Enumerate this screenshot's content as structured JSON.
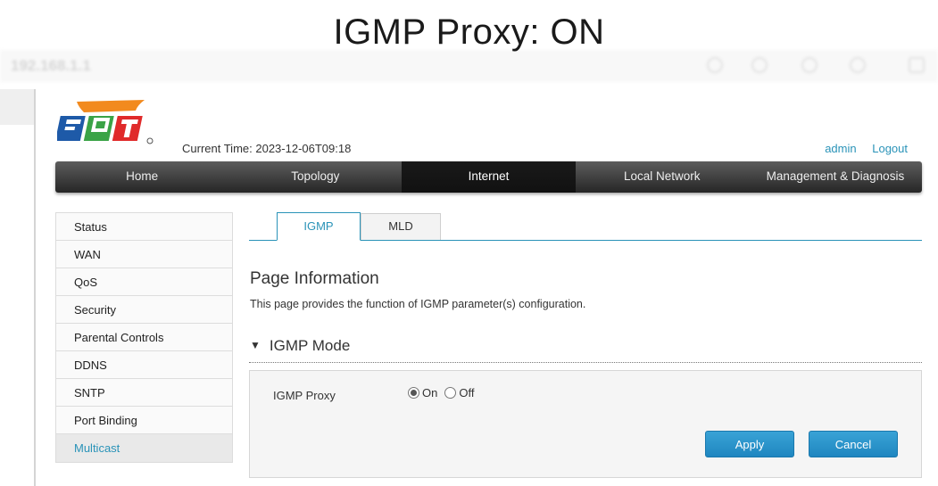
{
  "caption": "IGMP Proxy: ON",
  "browser": {
    "url": "192.168.1.1"
  },
  "header": {
    "current_time": "Current Time: 2023-12-06T09:18",
    "user": "admin",
    "logout": "Logout"
  },
  "nav": [
    {
      "label": "Home",
      "active": false
    },
    {
      "label": "Topology",
      "active": false
    },
    {
      "label": "Internet",
      "active": true
    },
    {
      "label": "Local Network",
      "active": false
    },
    {
      "label": "Management & Diagnosis",
      "active": false
    }
  ],
  "sidebar": [
    {
      "label": "Status"
    },
    {
      "label": "WAN"
    },
    {
      "label": "QoS"
    },
    {
      "label": "Security"
    },
    {
      "label": "Parental Controls"
    },
    {
      "label": "DDNS"
    },
    {
      "label": "SNTP"
    },
    {
      "label": "Port Binding"
    },
    {
      "label": "Multicast",
      "active": true
    }
  ],
  "tabs": [
    {
      "label": "IGMP",
      "active": true
    },
    {
      "label": "MLD",
      "active": false
    }
  ],
  "page_info": {
    "title": "Page Information",
    "description": "This page provides the function of IGMP parameter(s) configuration."
  },
  "section": {
    "title": "IGMP Mode",
    "field_label": "IGMP Proxy",
    "options": [
      {
        "label": "On",
        "checked": true
      },
      {
        "label": "Off",
        "checked": false
      }
    ]
  },
  "buttons": {
    "apply": "Apply",
    "cancel": "Cancel"
  },
  "colors": {
    "accent": "#2a93b8",
    "button": "#2b95cc",
    "nav_bg": "#2e2e2e"
  },
  "icons": [
    "fpt-logo",
    "collapse-triangle-icon",
    "radio-icon"
  ]
}
